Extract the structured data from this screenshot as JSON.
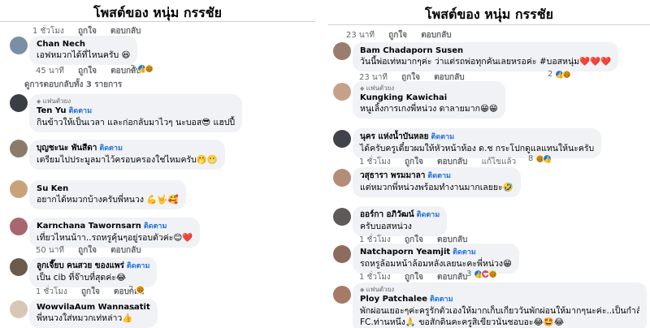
{
  "left": {
    "title": "โพสต์ของ หนุ่ม กรรชัย",
    "top_actions": {
      "time": "1 ชั่วโมง",
      "like": "ถูกใจ",
      "reply": "ตอบกลับ"
    },
    "comments": [
      {
        "name": "Chan Nech",
        "text": "เอฟหมวกได้ที่ไหนครับ 😆",
        "time": "45 นาที",
        "like": "ถูกใจ",
        "reply": "ตอบกลับ",
        "reactions": "2",
        "reaction_icons": [
          "like-icon",
          "haha-icon"
        ],
        "avatar_color": "#7a8fa6"
      },
      {
        "replies_link": "ดูการตอบกลับทั้ง 3 รายการ"
      },
      {
        "badge": "แฟนตัวยง",
        "name": "Ten Yu",
        "follow": "ติดตาม",
        "text": "กินข้าวให้เป็นเวลา และก่อกลับมาไวๆ นะบอส😎 แฮปปี้",
        "avatar_color": "#3a3f45"
      },
      {
        "name": "บุญชะนะ พันสีดา",
        "follow": "ติดตาม",
        "text": "เตรียมไปประมูลมาไว้ครอบครองใช่ไหมครับ🤭😬",
        "avatar_color": "#8b7b6a"
      },
      {
        "name": "Su Ken",
        "text": "อยากได้หมวกบ้างครับพี่หนวง 💪🤟🥰",
        "avatar_color": "#c9a27a"
      },
      {
        "name": "Karnchana Tawornsarn",
        "follow": "ติดตาม",
        "text": "เที่ยวไหนน้าา..รถหรูคุ้นๆอยู่รอบตัวค่ะ😊❤️",
        "time": "50 นาที",
        "like": "ถูกใจ",
        "reply": "ตอบกลับ",
        "avatar_color": "#a8676f"
      },
      {
        "name": "ลูกเจี๊ยบ คนสวย ของแพร่",
        "follow": "ติดตาม",
        "text": "เป็น cib ที่จ๊าบที่สุดค่ะ😂",
        "time": "1 ชั่วโมง",
        "like": "ถูกใจ",
        "reply": "ตอบกลับ",
        "reactions": "2",
        "reaction_icons": [
          "haha-icon"
        ],
        "avatar_color": "#6c5a4c"
      },
      {
        "name": "WowvilaAum Wannasatit",
        "text": "พี่หนวงใส่หมวกเท่หล่าว👍",
        "avatar_color": "#d8c7b7"
      }
    ]
  },
  "right": {
    "title": "โพสต์ของ หนุ่ม กรรชัย",
    "top_actions": {
      "time": "23 นาที",
      "like": "ถูกใจ",
      "reply": "ตอบกลับ"
    },
    "comments": [
      {
        "name": "Bam Chadaporn Susen",
        "text": "วันนี้พ่อเท่หมากๆค่ะ ว่าแต่รถพ่อทุกคันเลยหรอค่ะ #บอสหนุ่ม❤️❤️❤️",
        "time": "23 นาที",
        "like": "ถูกใจ",
        "reply": "ตอบกลับ",
        "reactions": "2",
        "reaction_icons": [
          "like-icon",
          "haha-icon"
        ],
        "avatar_color": "#9a7d6c"
      },
      {
        "badge": "แฟนตัวยง",
        "name": "Kungking Kawichai",
        "text": "หนูเลิ้งการเกงพี่หน่วง ดาลายมาก😁😁",
        "avatar_color": "#c7a08a"
      },
      {
        "name": "นุคร แห่งน้ำบันหลย",
        "follow": "ติดตาม",
        "text": "ได้ครับครูเดี๋ยวผมให้หัวหน้าห้อง ด.ช กระโปกดูแลแทนให้นะครับ",
        "time": "1 ชั่วโมง",
        "like": "ถูกใจ",
        "reply": "ตอบกลับ",
        "edited": "แก้ไขแล้ว",
        "reactions": "8",
        "reaction_icons": [
          "haha-icon",
          "like-icon"
        ],
        "avatar_color": "#40444a"
      },
      {
        "name": "วสุธารา พรมมาลา",
        "follow": "ติดตาม",
        "text": "แต่หมวกพี่หน่วงพร้อมทำงานมากเลยยะ🤣",
        "avatar_color": "#b48c7a"
      },
      {
        "name": "ออร์กา อภิวัฒน์",
        "follow": "ติดตาม",
        "text": "ครับบอสหน่วง",
        "time": "1 ชั่วโมง",
        "like": "ถูกใจ",
        "reply": "ตอบกลับ",
        "avatar_color": "#5d5a58"
      },
      {
        "name": "Natchaporn Yeamjit",
        "follow": "ติดตาม",
        "text": "รถหรูล้อมหน้าล้อมหลังเลยนะคะพี่หน่วง😁",
        "time": "1 ชั่วโมง",
        "like": "ถูกใจ",
        "reply": "ตอบกลับ",
        "reactions": "3",
        "reaction_icons": [
          "like-icon",
          "love-icon",
          "haha-icon"
        ],
        "avatar_color": "#8f6a5e"
      },
      {
        "badge": "แฟนตัวยง",
        "name": "Ploy Patchalee",
        "follow": "ติดตาม",
        "text": "พักผ่อนเยอะๆค่ะครูรักตัวเองให้มากเก็บเกี่ยววันพักผ่อนให้มากๆนะค่ะ..เป็นกำลังใจให้ครูเสมอค่ะ",
        "text2": "FC.ท่านหนึ่ง🙏 ขอสักดินคะครูสิเขียวนั่นชอบอะ😂🤩😂",
        "avatar_color": "#a67a66"
      }
    ]
  },
  "icons": {
    "like": "👍",
    "haha": "😆",
    "love": "❤",
    "more": "···"
  }
}
